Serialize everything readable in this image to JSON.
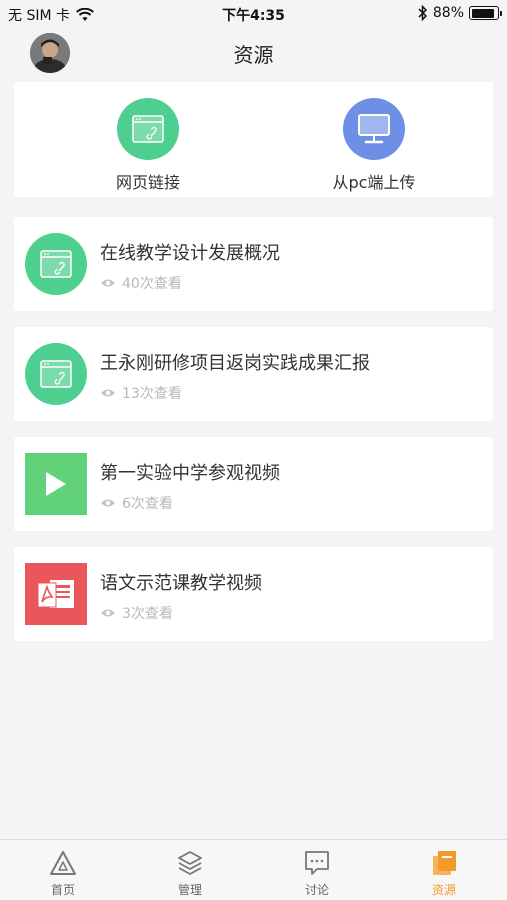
{
  "status_bar": {
    "carrier": "无 SIM 卡",
    "time": "下午4:35",
    "battery": "88%",
    "battery_level": 0.88
  },
  "nav": {
    "title": "资源"
  },
  "quick_actions": [
    {
      "label": "网页链接",
      "icon": "web-link-icon",
      "color": "#4fcf8f"
    },
    {
      "label": "从pc端上传",
      "icon": "monitor-icon",
      "color": "#6e8fe6"
    }
  ],
  "resources": [
    {
      "title": "在线教学设计发展概况",
      "views": "40次查看",
      "icon": "web-link-icon",
      "color": "#4fcf8f"
    },
    {
      "title": "王永刚研修项目返岗实践成果汇报",
      "views": "13次查看",
      "icon": "web-link-icon",
      "color": "#4fcf8f"
    },
    {
      "title": "第一实验中学参观视频",
      "views": "6次查看",
      "icon": "play-icon",
      "color": "#62d27a"
    },
    {
      "title": "语文示范课教学视频",
      "views": "3次查看",
      "icon": "pdf-icon",
      "color": "#e9575a"
    }
  ],
  "tabs": [
    {
      "label": "首页",
      "icon": "home-triangle-icon",
      "active": false
    },
    {
      "label": "管理",
      "icon": "layers-icon",
      "active": false
    },
    {
      "label": "讨论",
      "icon": "chat-icon",
      "active": false
    },
    {
      "label": "资源",
      "icon": "resource-book-icon",
      "active": true
    }
  ],
  "colors": {
    "accent": "#f39a2b",
    "background": "#f4f4f6"
  }
}
